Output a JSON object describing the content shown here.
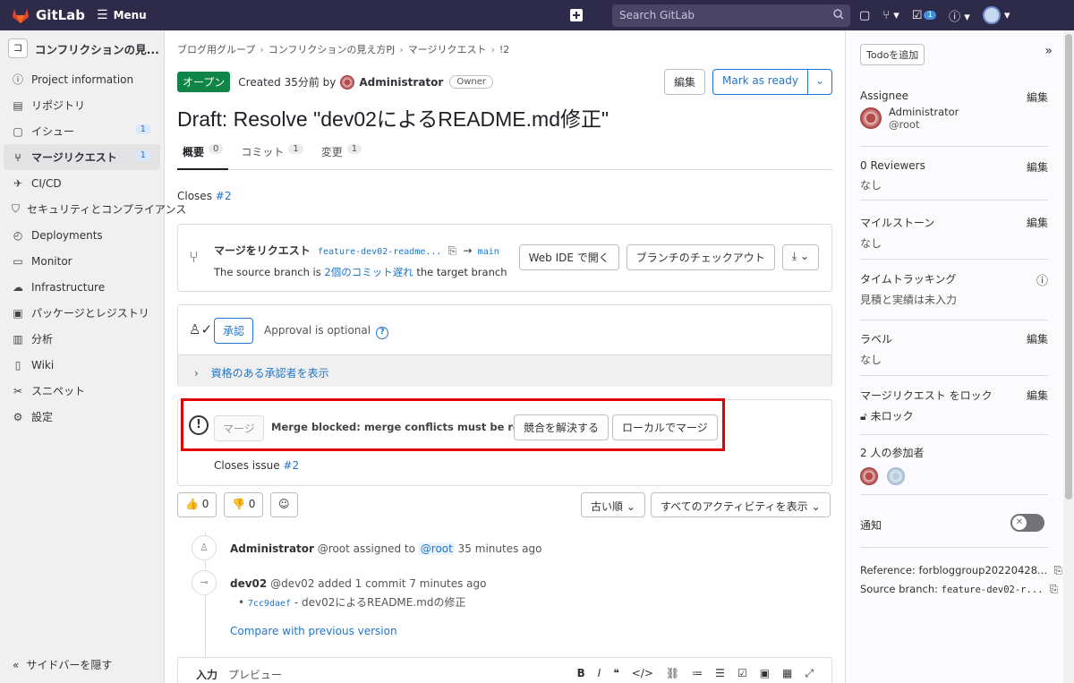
{
  "topbar": {
    "logo_text": "GitLab",
    "menu_label": "Menu",
    "search_placeholder": "Search GitLab",
    "todo_count": "1"
  },
  "sidebar": {
    "project_initial": "コ",
    "project_name": "コンフリクションの見...",
    "items": [
      {
        "label": "Project information",
        "icon": "info-icon"
      },
      {
        "label": "リポジトリ",
        "icon": "doc-icon"
      },
      {
        "label": "イシュー",
        "icon": "issues-icon",
        "count": "1"
      },
      {
        "label": "マージリクエスト",
        "icon": "merge-request-icon",
        "count": "1"
      },
      {
        "label": "CI/CD",
        "icon": "rocket-icon"
      },
      {
        "label": "セキュリティとコンプライアンス",
        "icon": "shield-icon"
      },
      {
        "label": "Deployments",
        "icon": "deploy-icon"
      },
      {
        "label": "Monitor",
        "icon": "monitor-icon"
      },
      {
        "label": "Infrastructure",
        "icon": "cloud-icon"
      },
      {
        "label": "パッケージとレジストリ",
        "icon": "package-icon"
      },
      {
        "label": "分析",
        "icon": "chart-icon"
      },
      {
        "label": "Wiki",
        "icon": "book-icon"
      },
      {
        "label": "スニペット",
        "icon": "scissors-icon"
      },
      {
        "label": "設定",
        "icon": "gear-icon"
      }
    ],
    "hide_label": "サイドバーを隠す"
  },
  "main": {
    "breadcrumb": [
      "ブログ用グループ",
      "コンフリクションの見え方PJ",
      "マージリクエスト",
      "!2"
    ],
    "status": "オープン",
    "created_text": "Created 35分前 by",
    "author": "Administrator",
    "owner_badge": "Owner",
    "edit_label": "編集",
    "mark_ready_label": "Mark as ready",
    "title": "Draft: Resolve \"dev02によるREADME.md修正\"",
    "tabs": [
      {
        "label": "概要",
        "count": "0"
      },
      {
        "label": "コミット",
        "count": "1"
      },
      {
        "label": "変更",
        "count": "1"
      }
    ],
    "closes_label": "Closes",
    "closes_ref": "#2",
    "branch_widget": {
      "title": "マージをリクエスト",
      "source_branch": "feature-dev02-readme...",
      "arrow": "→",
      "target_branch": "main",
      "line2_prefix": "The source branch is",
      "line2_link": "2個のコミット遅れ",
      "line2_suffix": "the target branch",
      "web_ide_label": "Web IDE で開く",
      "checkout_label": "ブランチのチェックアウト"
    },
    "approval": {
      "approve_label": "承認",
      "optional_text": "Approval is optional",
      "expand_label": "資格のある承認者を表示"
    },
    "merge_widget": {
      "merge_label": "マージ",
      "blocked_text": "Merge blocked: merge conflicts must be resolved.",
      "resolve_label": "競合を解決する",
      "local_merge_label": "ローカルでマージ",
      "closes_issue_label": "Closes issue",
      "closes_issue_ref": "#2"
    },
    "reactions": {
      "thumbs_up": "0",
      "thumbs_down": "0",
      "sort_label": "古い順",
      "filter_label": "すべてのアクティビティを表示"
    },
    "activity": [
      {
        "author": "Administrator",
        "handle": "@root",
        "action": "assigned to",
        "mention": "@root",
        "time": "35 minutes ago"
      },
      {
        "author": "dev02",
        "handle": "@dev02",
        "action": "added 1 commit",
        "time": "7 minutes ago",
        "commit_sha": "7cc9daef",
        "commit_msg": "- dev02によるREADME.mdの修正",
        "compare_label": "Compare with previous version"
      }
    ],
    "editor": {
      "write_tab": "入力",
      "preview_tab": "プレビュー"
    }
  },
  "right_sidebar": {
    "todo_label": "Todoを追加",
    "edit_label": "編集",
    "assignee_title": "Assignee",
    "assignee_name": "Administrator",
    "assignee_handle": "@root",
    "reviewers_title": "0 Reviewers",
    "reviewers_value": "なし",
    "milestone_title": "マイルストーン",
    "milestone_value": "なし",
    "time_title": "タイムトラッキング",
    "time_value": "見積と実績は未入力",
    "labels_title": "ラベル",
    "labels_value": "なし",
    "lock_title": "マージリクエスト をロック",
    "lock_value": "未ロック",
    "participants_title": "2 人の参加者",
    "notify_title": "通知",
    "reference_text": "Reference: forbloggroup20220428...",
    "source_branch_label": "Source branch:",
    "source_branch_value": "feature-dev02-r..."
  }
}
